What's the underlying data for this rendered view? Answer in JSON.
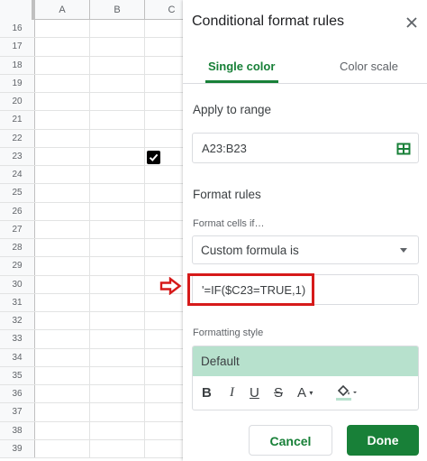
{
  "sheet": {
    "columns": [
      "A",
      "B",
      "C"
    ],
    "rows": [
      "16",
      "17",
      "18",
      "19",
      "20",
      "21",
      "22",
      "23",
      "24",
      "25",
      "26",
      "27",
      "28",
      "29",
      "30",
      "31",
      "32",
      "33",
      "34",
      "35",
      "36",
      "37",
      "38",
      "39"
    ],
    "checked_row": "23"
  },
  "panel": {
    "title": "Conditional format rules",
    "tabs": {
      "single": "Single color",
      "scale": "Color scale"
    },
    "apply_to_range_label": "Apply to range",
    "range_value": "A23:B23",
    "format_rules_label": "Format rules",
    "format_cells_if_label": "Format cells if…",
    "condition_value": "Custom formula is",
    "formula_value": "'=IF($C23=TRUE,1)",
    "formatting_style_label": "Formatting style",
    "style_preview": "Default",
    "toolbar": {
      "bold": "B",
      "italic": "I",
      "underline": "U",
      "strike": "S",
      "text_color": "A"
    },
    "cancel_label": "Cancel",
    "done_label": "Done"
  },
  "colors": {
    "accent": "#188038",
    "preview_fill": "#b7e1cd",
    "highlight": "#d61a1a"
  },
  "icons": [
    "close-icon",
    "grid-range-icon",
    "dropdown-caret-icon",
    "red-arrow-icon",
    "fill-color-icon",
    "checkbox-checked-icon"
  ]
}
